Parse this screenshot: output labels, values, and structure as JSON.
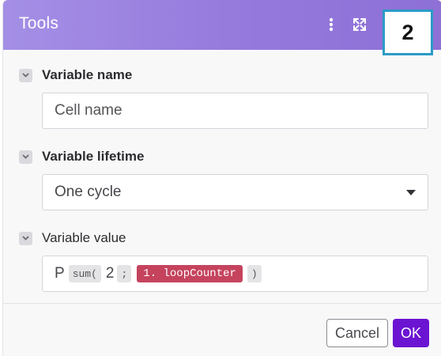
{
  "header": {
    "title": "Tools",
    "menu_icon": "kebab-menu-icon",
    "expand_icon": "expand-arrows-icon"
  },
  "step_badge": "2",
  "fields": {
    "variable_name": {
      "label": "Variable name",
      "value": "Cell name"
    },
    "variable_lifetime": {
      "label": "Variable lifetime",
      "value": "One cycle"
    },
    "variable_value": {
      "label": "Variable value",
      "prefix": "P",
      "func_open": "sum(",
      "arg1": "2",
      "separator": ";",
      "reference": "1. loopCounter",
      "func_close": ")"
    }
  },
  "footer": {
    "cancel_label": "Cancel",
    "ok_label": "OK"
  },
  "colors": {
    "header_gradient_start": "#a48fe6",
    "header_gradient_end": "#8e70d6",
    "ok_button": "#6b14d1",
    "reference_chip": "#c5435d",
    "badge_border": "#2a9bc6"
  }
}
